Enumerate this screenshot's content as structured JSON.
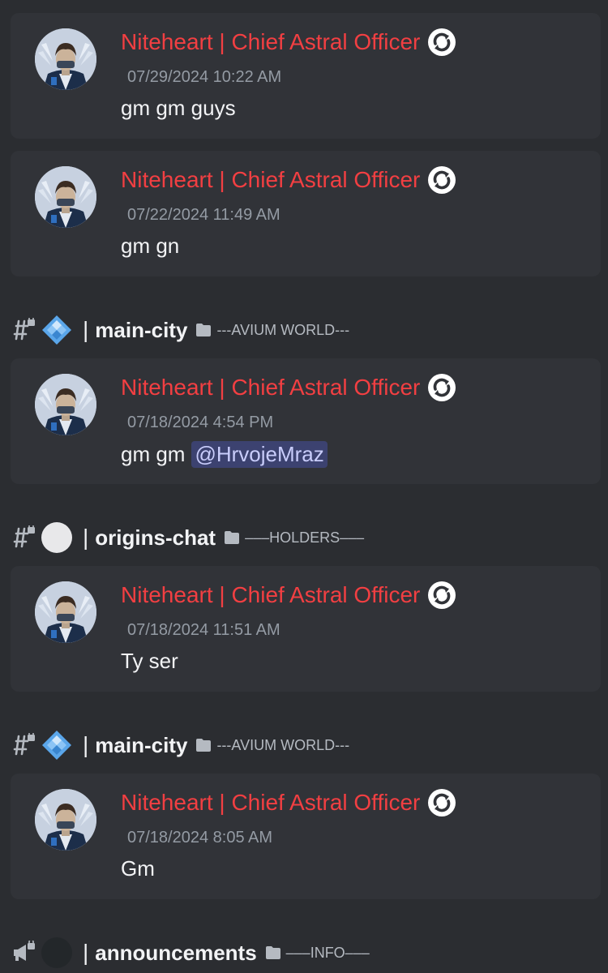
{
  "colors": {
    "background": "#2b2d31",
    "card": "#313338",
    "author_name": "#f23f42",
    "timestamp": "#949ba4",
    "text": "#f2f3f5",
    "mention_bg": "#3c4270",
    "mention_text": "#c9cdfb"
  },
  "results": [
    {
      "author": "Niteheart | Chief Astral Officer",
      "role_icon": "refresh-circle-icon",
      "timestamp": "07/29/2024 10:22 AM",
      "text": "gm gm guys",
      "mention": ""
    },
    {
      "author": "Niteheart | Chief Astral Officer",
      "role_icon": "refresh-circle-icon",
      "timestamp": "07/22/2024 11:49 AM",
      "text": "gm gn",
      "mention": ""
    },
    {
      "channel": {
        "icon": "locked-hash-icon",
        "emoji": "blue-diamond-emoji",
        "separator": "|",
        "name": "main-city",
        "category": "---AVIUM WORLD---"
      },
      "author": "Niteheart | Chief Astral Officer",
      "role_icon": "refresh-circle-icon",
      "timestamp": "07/18/2024 4:54 PM",
      "text": "gm gm",
      "mention": "@HrvojeMraz"
    },
    {
      "channel": {
        "icon": "locked-hash-icon",
        "emoji": "white-circle-emoji",
        "separator": "|",
        "name": "origins-chat",
        "category": "–––HOLDERS–––"
      },
      "author": "Niteheart | Chief Astral Officer",
      "role_icon": "refresh-circle-icon",
      "timestamp": "07/18/2024 11:51 AM",
      "text": "Ty ser",
      "mention": ""
    },
    {
      "channel": {
        "icon": "locked-hash-icon",
        "emoji": "blue-diamond-emoji",
        "separator": "|",
        "name": "main-city",
        "category": "---AVIUM WORLD---"
      },
      "author": "Niteheart | Chief Astral Officer",
      "role_icon": "refresh-circle-icon",
      "timestamp": "07/18/2024 8:05 AM",
      "text": "Gm",
      "mention": ""
    }
  ],
  "footer_channel": {
    "icon": "megaphone-locked-icon",
    "emoji": "dark-circle-emoji",
    "separator": "|",
    "name": "announcements",
    "category": "–––INFO–––"
  }
}
